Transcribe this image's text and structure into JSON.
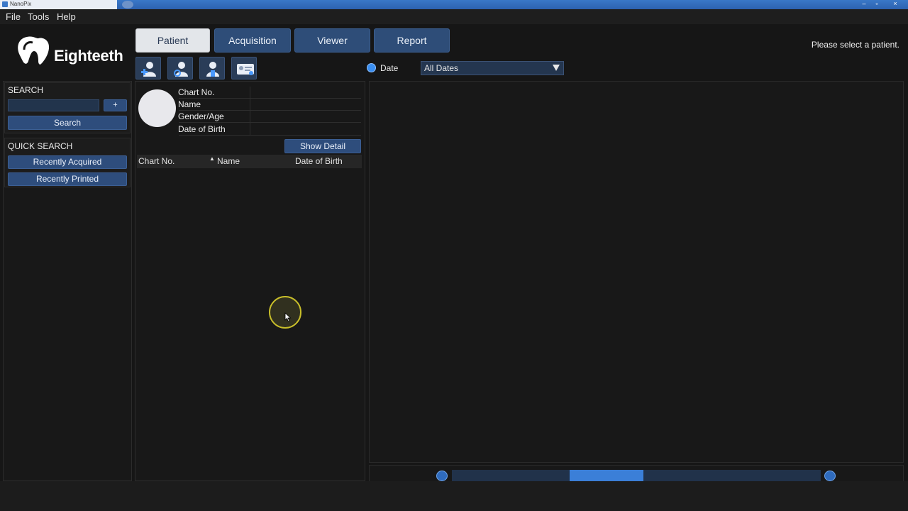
{
  "window": {
    "title": "NanoPix"
  },
  "menu": [
    "File",
    "Tools",
    "Help"
  ],
  "logo": {
    "text": "Eighteeth"
  },
  "tabs": [
    {
      "label": "Patient",
      "active": true
    },
    {
      "label": "Acquisition",
      "active": false
    },
    {
      "label": "Viewer",
      "active": false
    },
    {
      "label": "Report",
      "active": false
    }
  ],
  "status_message": "Please select a patient.",
  "toolbar": {
    "icons": [
      "add-patient-icon",
      "search-patient-icon",
      "edit-patient-icon",
      "patient-card-icon"
    ]
  },
  "date_filter": {
    "label": "Date",
    "selected": "All Dates"
  },
  "search": {
    "title": "SEARCH",
    "input_value": "",
    "plus_label": "+",
    "button_label": "Search"
  },
  "quick_search": {
    "title": "QUICK SEARCH",
    "buttons": [
      "Recently Acquired",
      "Recently Printed"
    ]
  },
  "patient_info": {
    "labels": [
      "Chart No.",
      "Name",
      "Gender/Age",
      "Date of Birth"
    ],
    "show_detail_label": "Show Detail"
  },
  "patient_list": {
    "columns": [
      "Chart No.",
      "Name",
      "Date of Birth"
    ],
    "sort_indicator": "▲",
    "rows": []
  },
  "scrollbar": {
    "position": 0.4,
    "thumb_fraction": 0.2
  },
  "colors": {
    "accent": "#2e4d7c",
    "accent_bright": "#3b7fd8",
    "background": "#161616",
    "active_tab": "#e3e6ea"
  }
}
